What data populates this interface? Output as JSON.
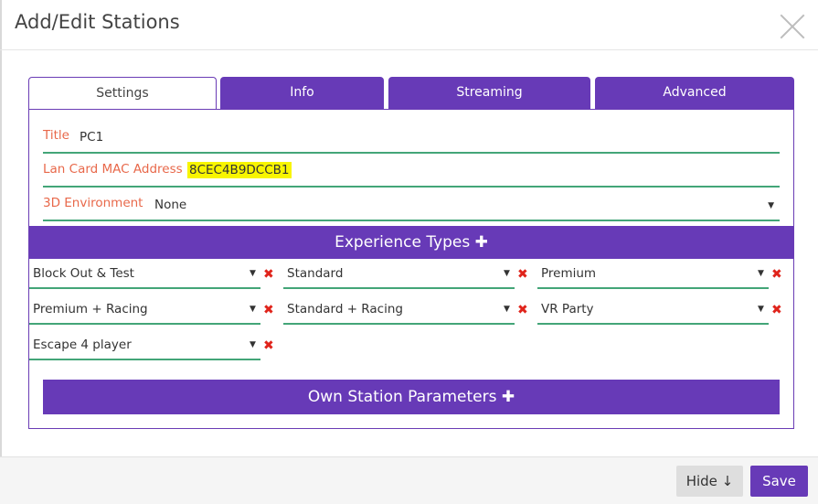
{
  "dialog": {
    "title": "Add/Edit Stations"
  },
  "tabs": [
    {
      "label": "Settings",
      "active": true
    },
    {
      "label": "Info",
      "active": false
    },
    {
      "label": "Streaming",
      "active": false
    },
    {
      "label": "Advanced",
      "active": false
    }
  ],
  "form": {
    "title_label": "Title",
    "title_value": "PC1",
    "mac_label": "Lan Card MAC Address",
    "mac_value": "8CEC4B9DCCB1",
    "env_label": "3D Environment",
    "env_value": "None"
  },
  "experience": {
    "header": "Experience Types",
    "plus": "✚",
    "caret": "▼",
    "remove": "✖",
    "items": [
      "Block Out & Test",
      "Standard",
      "Premium",
      "Premium + Racing",
      "Standard + Racing",
      "VR Party",
      "Escape 4 player"
    ]
  },
  "own_params": {
    "header": "Own Station Parameters",
    "plus": "✚"
  },
  "footer": {
    "hide_label": "Hide ↓",
    "save_label": "Save"
  },
  "colors": {
    "accent": "#673ab7",
    "label": "#e8684a",
    "underline": "#43a578",
    "remove": "#e0241b",
    "highlight": "#f8f500"
  }
}
